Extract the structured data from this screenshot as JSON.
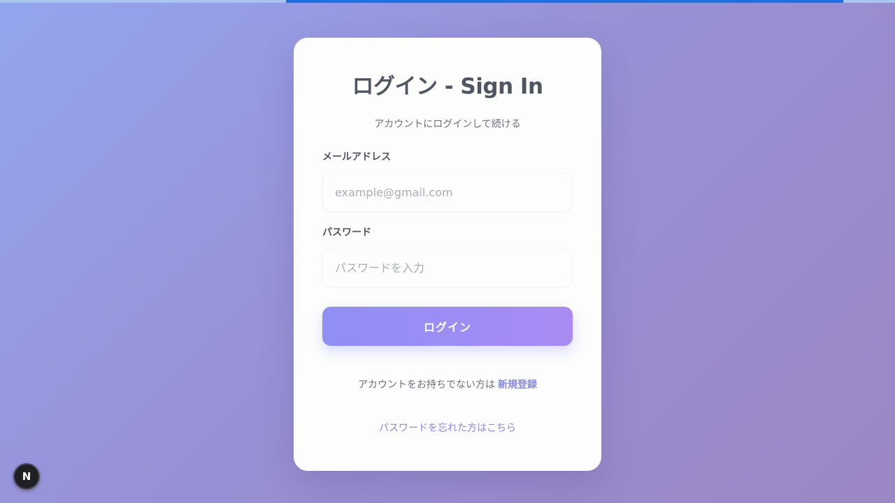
{
  "progress_fraction": 0.62,
  "login_form": {
    "title": "ログイン - Sign In",
    "subtitle": "アカウントにログインして続ける",
    "email_label": "メールアドレス",
    "email_placeholder": "example@gmail.com",
    "email_value": "",
    "password_label": "パスワード",
    "password_placeholder": "パスワードを入力",
    "password_value": "",
    "submit_label": "ログイン",
    "signup_prompt": "アカウントをお持ちでない方は",
    "signup_link": "新規登録",
    "forgot_link": "パスワードを忘れた方はこちら"
  },
  "dev_badge": {
    "letter": "N",
    "icon": "nextjs-icon"
  },
  "colors": {
    "accent": "#8f8ff6",
    "accent_end": "#a98bf3",
    "link": "#8a86e6",
    "progress": "#1e6fe0"
  }
}
